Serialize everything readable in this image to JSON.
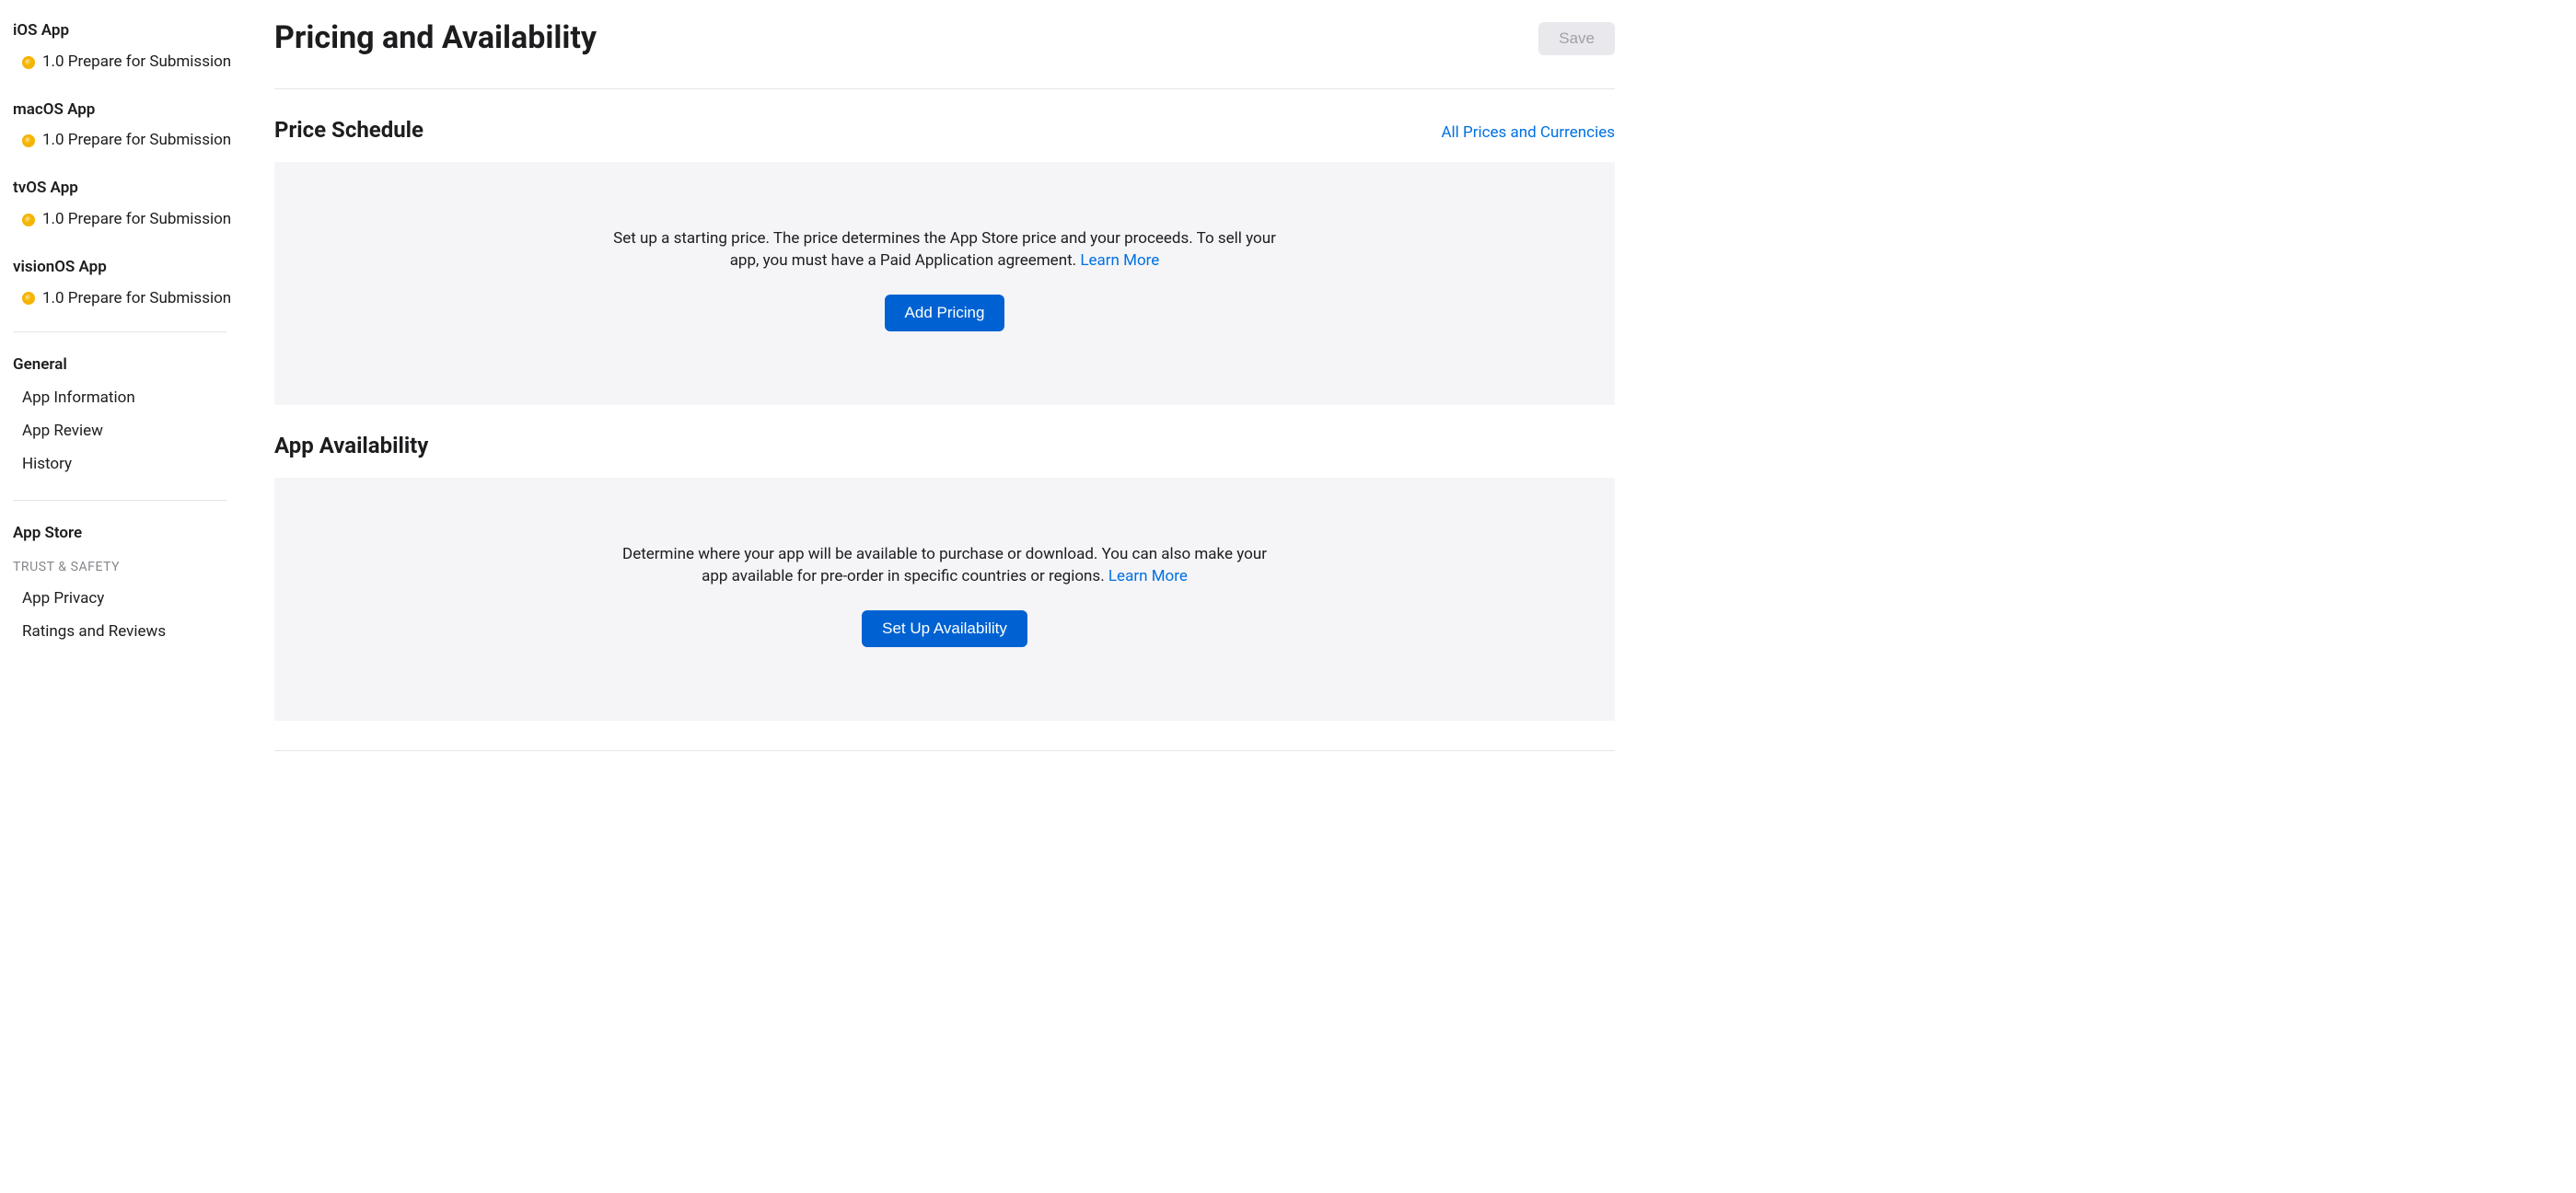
{
  "sidebar": {
    "platforms": [
      {
        "name": "iOS App",
        "version": "1.0 Prepare for Submission"
      },
      {
        "name": "macOS App",
        "version": "1.0 Prepare for Submission"
      },
      {
        "name": "tvOS App",
        "version": "1.0 Prepare for Submission"
      },
      {
        "name": "visionOS App",
        "version": "1.0 Prepare for Submission"
      }
    ],
    "general": {
      "title": "General",
      "items": [
        "App Information",
        "App Review",
        "History"
      ]
    },
    "appstore": {
      "title": "App Store",
      "subhead": "TRUST & SAFETY",
      "items": [
        "App Privacy",
        "Ratings and Reviews"
      ]
    }
  },
  "header": {
    "title": "Pricing and Availability",
    "save": "Save"
  },
  "price": {
    "title": "Price Schedule",
    "allLink": "All Prices and Currencies",
    "desc": "Set up a starting price. The price determines the App Store price and your proceeds. To sell your app, you must have a Paid Application agreement. ",
    "learn": "Learn More",
    "cta": "Add Pricing"
  },
  "availability": {
    "title": "App Availability",
    "desc": "Determine where your app will be available to purchase or download. You can also make your app available for pre-order in specific countries or regions. ",
    "learn": "Learn More",
    "cta": "Set Up Availability"
  }
}
